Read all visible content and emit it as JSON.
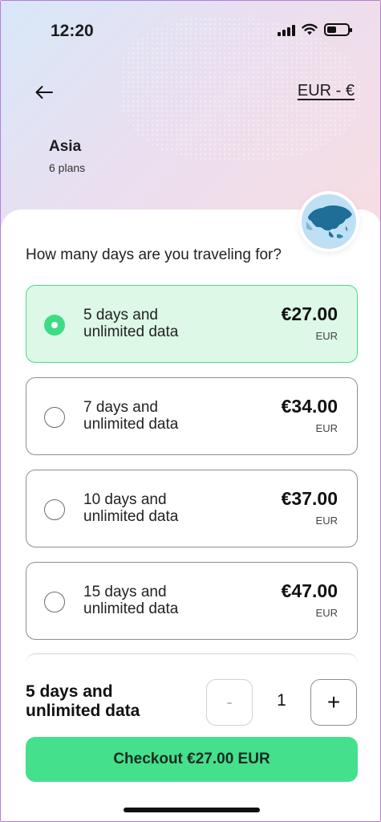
{
  "status_bar": {
    "time": "12:20",
    "battery_level": 0.45
  },
  "header": {
    "back_icon": "arrow-left-icon",
    "currency_label": "EUR - €"
  },
  "region": {
    "name": "Asia",
    "plans_count": "6 plans",
    "map_icon": "asia-globe-icon"
  },
  "question": "How many days are you traveling for?",
  "plans": [
    {
      "line1": "5 days and",
      "line2": "unlimited data",
      "price": "€27.00",
      "currency": "EUR",
      "selected": true
    },
    {
      "line1": "7 days and",
      "line2": "unlimited data",
      "price": "€34.00",
      "currency": "EUR",
      "selected": false
    },
    {
      "line1": "10 days and",
      "line2": "unlimited data",
      "price": "€37.00",
      "currency": "EUR",
      "selected": false
    },
    {
      "line1": "15 days and",
      "line2": "unlimited data",
      "price": "€47.00",
      "currency": "EUR",
      "selected": false
    }
  ],
  "summary": {
    "line1": "5 days and",
    "line2": "unlimited data",
    "minus_label": "-",
    "quantity": "1",
    "plus_label": "+"
  },
  "checkout_label": "Checkout €27.00 EUR",
  "colors": {
    "selected_bg": "#ddf8e6",
    "selected_border": "#4cd98a",
    "accent": "#44e08c"
  }
}
